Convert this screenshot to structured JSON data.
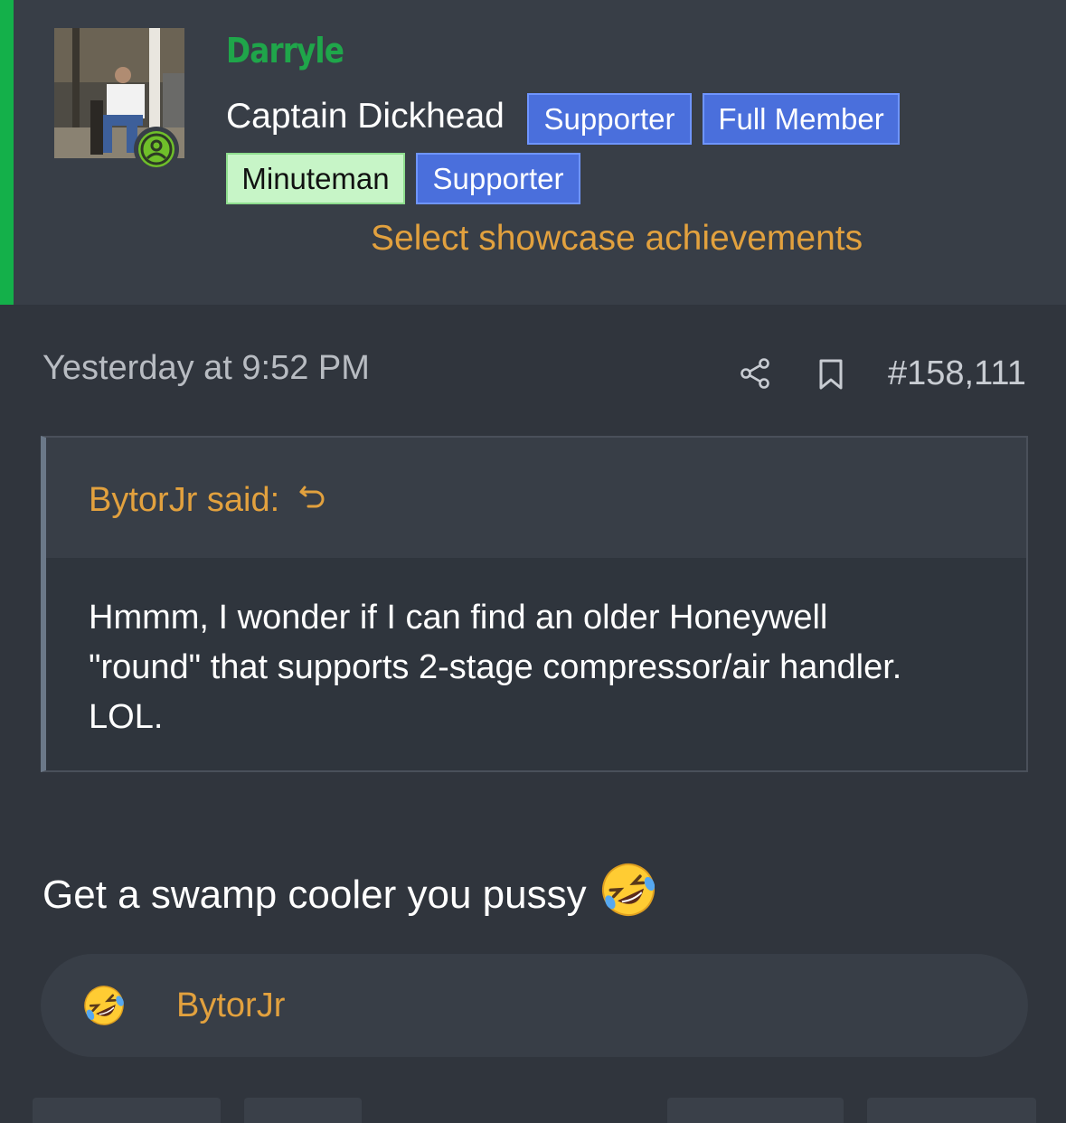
{
  "user": {
    "name": "Darryle",
    "title": "Captain Dickhead",
    "badges": [
      "Supporter",
      "Full Member",
      "Minuteman",
      "Supporter"
    ],
    "showcase_link": "Select showcase achievements"
  },
  "post": {
    "timestamp": "Yesterday at 9:52 PM",
    "number": "#158,111",
    "quote": {
      "author": "BytorJr said:",
      "text_lines": [
        "Hmmm, I wonder if I can find an older Honeywell",
        "\"round\" that supports 2-stage compressor/air handler.",
        "LOL."
      ]
    },
    "message": "Get a swamp cooler you pussy",
    "message_emoji": "rolling-on-floor-laughing-emoji"
  },
  "reactions": {
    "emoji": "rolling-on-floor-laughing-emoji",
    "users": "BytorJr"
  },
  "colors": {
    "accent_green": "#14b04a",
    "username_green": "#1fa64a",
    "link_orange": "#e2a13e",
    "badge_blue": "#4a6fdc",
    "badge_green": "#c7f5c7"
  }
}
